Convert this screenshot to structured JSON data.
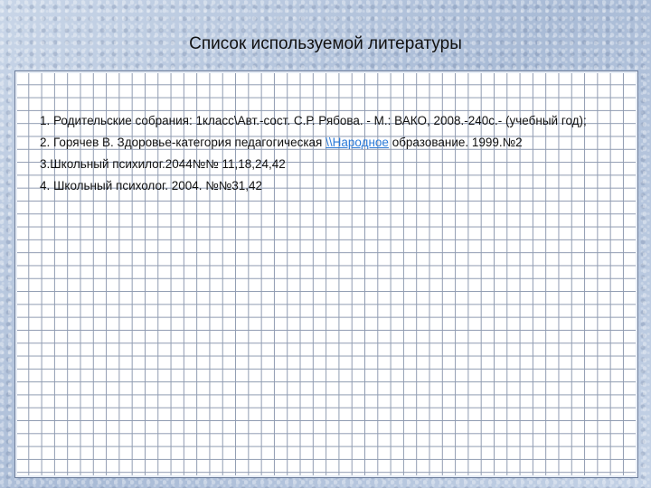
{
  "slide": {
    "title": "Список используемой литературы"
  },
  "references": [
    {
      "text": "1. Родительские собрания: 1класс\\Авт.-сост. С.Р. Рябова. - М.: ВАКО, 2008.-240с.- (учебный год);"
    },
    {
      "text_before": "2. Горячев В. Здоровье-категория педагогическая ",
      "link": "\\\\Народное",
      "text_after": " образование. 1999.№2"
    },
    {
      "text": "3.Школьный психилог.2044№№ 11,18,24,42"
    },
    {
      "text": "4. Школьный психолог. 2004. №№31,42"
    }
  ]
}
